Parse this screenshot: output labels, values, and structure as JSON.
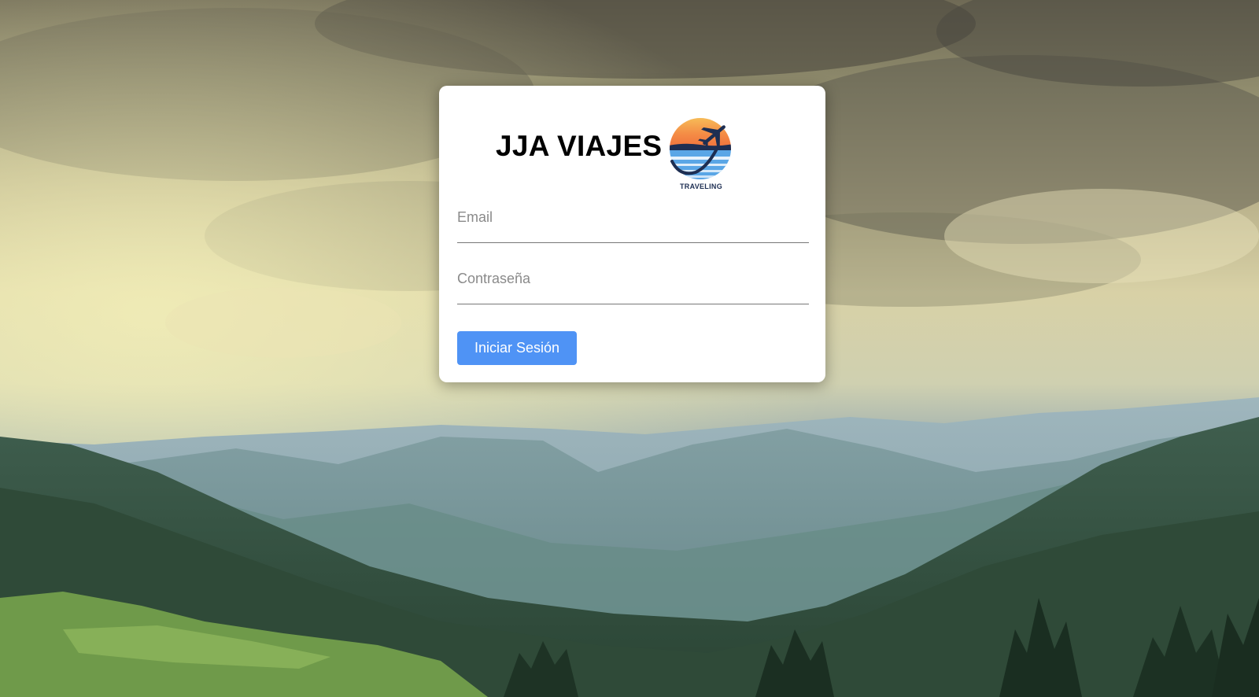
{
  "brand": {
    "title": "JJA VIAJES",
    "logo_caption": "TRAVELING",
    "logo_icon": "airplane-sunset-logo"
  },
  "login_form": {
    "email_placeholder": "Email",
    "email_value": "",
    "password_placeholder": "Contraseña",
    "password_value": "",
    "submit_label": "Iniciar Sesión"
  },
  "colors": {
    "button": "#4f93f5",
    "card": "#ffffff",
    "title": "#000000",
    "logo_navy": "#1d2e52"
  },
  "background": {
    "scene": "mountain-landscape-cloudy-sky"
  }
}
